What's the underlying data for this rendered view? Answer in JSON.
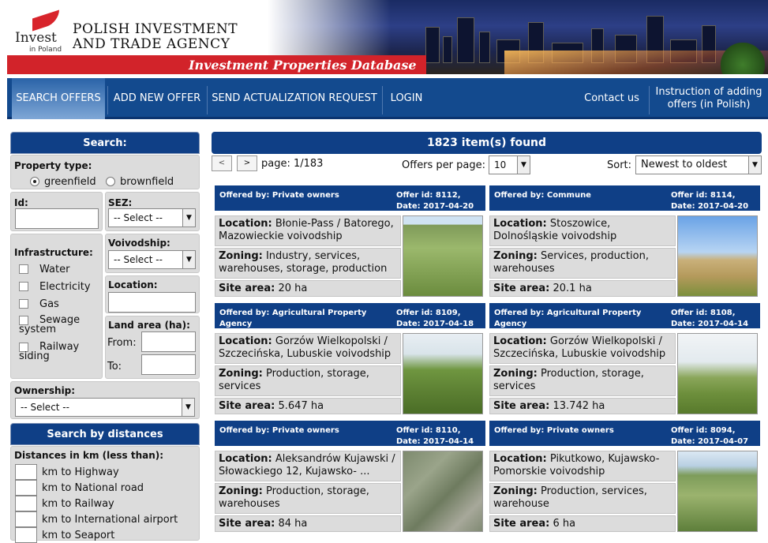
{
  "header": {
    "logo_text_1": "Invest",
    "logo_text_2": "in Poland",
    "agency_line1": "POLISH INVESTMENT",
    "agency_line2": "AND TRADE AGENCY",
    "banner": "Investment Properties Database"
  },
  "nav": {
    "items": [
      "SEARCH OFFERS",
      "ADD NEW OFFER",
      "SEND ACTUALIZATION REQUEST",
      "LOGIN"
    ],
    "contact": "Contact us",
    "instruction_line1": "Instruction of adding",
    "instruction_line2": "offers (in Polish)"
  },
  "search": {
    "title": "Search:",
    "property_type_label": "Property type:",
    "greenfield": "greenfield",
    "brownfield": "brownfield",
    "id_label": "Id:",
    "sez_label": "SEZ:",
    "sez_value": "-- Select --",
    "infrastructure_label": "Infrastructure:",
    "infra": [
      "Water",
      "Electricity",
      "Gas",
      "Sewage system",
      "Railway siding"
    ],
    "voivodship_label": "Voivodship:",
    "voivodship_value": "-- Select --",
    "location_label": "Location:",
    "land_area_label": "Land area (ha):",
    "from": "From:",
    "to": "To:",
    "ownership_label": "Ownership:",
    "ownership_value": "-- Select --"
  },
  "distances": {
    "title": "Search by distances",
    "subtitle": "Distances in km (less than):",
    "items": [
      "km to Highway",
      "km to National road",
      "km to Railway",
      "km to International airport",
      "km to Seaport"
    ]
  },
  "results": {
    "count_text": "1823 item(s) found",
    "prev": "<",
    "next": ">",
    "page_text": "page: 1/183",
    "per_page_label": "Offers per page:",
    "per_page_value": "10",
    "sort_label": "Sort:",
    "sort_value": "Newest to oldest"
  },
  "offers": [
    {
      "by": "Offered by: Private owners",
      "id": "Offer id: 8112,",
      "date": "Date: 2017-04-20",
      "loc_label": "Location:",
      "location": "Błonie-Pass / Batorego, Mazowieckie voivodship",
      "zon_label": "Zoning:",
      "zoning": "Industry, services, warehouses, storage, production",
      "area_label": "Site area:",
      "area": "20 ha"
    },
    {
      "by": "Offered by: Commune",
      "id": "Offer id: 8114,",
      "date": "Date: 2017-04-20",
      "loc_label": "Location:",
      "location": "Stoszowice, Dolnośląskie voivodship",
      "zon_label": "Zoning:",
      "zoning": "Services, production, warehouses",
      "area_label": "Site area:",
      "area": "20.1 ha"
    },
    {
      "by": "Offered by: Agricultural Property Agency",
      "id": "Offer id: 8109,",
      "date": "Date: 2017-04-18",
      "loc_label": "Location:",
      "location": "Gorzów Wielkopolski / Szczecińska, Lubuskie voivodship",
      "zon_label": "Zoning:",
      "zoning": "Production, storage, services",
      "area_label": "Site area:",
      "area": "5.647 ha"
    },
    {
      "by": "Offered by: Agricultural Property Agency",
      "id": "Offer id: 8108,",
      "date": "Date: 2017-04-14",
      "loc_label": "Location:",
      "location": "Gorzów Wielkopolski / Szczecińska, Lubuskie voivodship",
      "zon_label": "Zoning:",
      "zoning": "Production, storage, services",
      "area_label": "Site area:",
      "area": "13.742 ha"
    },
    {
      "by": "Offered by: Private owners",
      "id": "Offer id: 8110,",
      "date": "Date: 2017-04-14",
      "loc_label": "Location:",
      "location": "Aleksandrów Kujawski / Słowackiego 12, Kujawsko-",
      "zon_label": "Zoning:",
      "zoning": "Production, storage, warehouses",
      "area_label": "Site area:",
      "area": "84 ha"
    },
    {
      "by": "Offered by: Private owners",
      "id": "Offer id: 8094,",
      "date": "Date: 2017-04-07",
      "loc_label": "Location:",
      "location": "Pikutkowo, Kujawsko-Pomorskie voivodship",
      "zon_label": "Zoning:",
      "zoning": "Production, services, warehouse",
      "area_label": "Site area:",
      "area": "6 ha"
    }
  ]
}
